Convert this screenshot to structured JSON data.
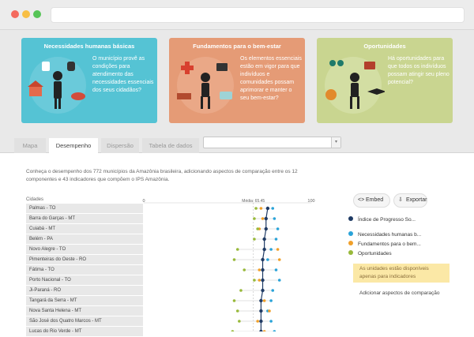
{
  "cards": [
    {
      "title": "Necessidades humanas básicas",
      "text": "O município provê as condições para atendimento das necessidades essenciais dos seus cidadãos?",
      "color": "#55c3d4"
    },
    {
      "title": "Fundamentos para o bem-estar",
      "text": "Os elementos essenciais estão em vigor para que indivíduos e comunidades possam aprimorar e manter o seu bem-estar?",
      "color": "#e59b76"
    },
    {
      "title": "Oportunidades",
      "text": "Há oportunidades para que todos os indivíduos possam atingir seu pleno potencial?",
      "color": "#c9d590"
    }
  ],
  "tabs": [
    {
      "label": "Mapa",
      "active": false
    },
    {
      "label": "Desempenho",
      "active": true
    },
    {
      "label": "Dispersão",
      "active": false
    },
    {
      "label": "Tabela de dados",
      "active": false
    }
  ],
  "intro": "Conheça o desempenho dos 772 municípios da Amazônia brasileira, adicionando aspectos de comparação entre os 12 componentes e 43 indicadores que compõem o IPS Amazônia.",
  "table": {
    "header": "Cidades",
    "rows": [
      "Palmas - TO",
      "Barra do Garças - MT",
      "Cuiabá - MT",
      "Belém - PA",
      "Novo Alegre - TO",
      "Pimenteiras do Oeste - RO",
      "Fátima - TO",
      "Porto Nacional - TO",
      "Ji-Paraná - RO",
      "Tangará da Serra - MT",
      "Nova Santa Helena - MT",
      "São José dos Quatro Marcos - MT",
      "Lucas do Rio Verde - MT"
    ]
  },
  "buttons": {
    "embed": "Embed",
    "export": "Exportar"
  },
  "legend": [
    {
      "label": "Índice de Progresso So...",
      "color": "#1f3a64"
    },
    {
      "label": "Necessidades humanas b...",
      "color": "#2aa3d8"
    },
    {
      "label": "Fundamentos para o bem...",
      "color": "#f0a02a"
    },
    {
      "label": "Oportunidades",
      "color": "#98b93a"
    }
  ],
  "notice": "As unidades estão disponíveis apenas para indicadores",
  "add_link": "Adicionar aspectos de comparação",
  "chart_data": {
    "type": "scatter",
    "axis_min": 0,
    "axis_max": 100,
    "axis_ticks": [
      "0",
      "100"
    ],
    "mean_label": "Média: 65.45",
    "mean_value": 65.45,
    "categories": [
      "Palmas - TO",
      "Barra do Garças - MT",
      "Cuiabá - MT",
      "Belém - PA",
      "Novo Alegre - TO",
      "Pimenteiras do Oeste - RO",
      "Fátima - TO",
      "Porto Nacional - TO",
      "Ji-Paraná - RO",
      "Tangará da Serra - MT",
      "Nova Santa Helena - MT",
      "São José dos Quatro Marcos - MT",
      "Lucas do Rio Verde - MT"
    ],
    "series": [
      {
        "name": "Índice de Progresso So...",
        "color": "#1f3a64",
        "values": [
          74,
          73,
          73,
          72,
          72,
          71,
          71,
          71,
          71,
          70,
          70,
          70,
          70
        ]
      },
      {
        "name": "Necessidades humanas b...",
        "color": "#2aa3d8",
        "values": [
          77,
          78,
          80,
          79,
          76,
          74,
          79,
          81,
          77,
          76,
          74,
          76,
          78
        ]
      },
      {
        "name": "Fundamentos para o bem...",
        "color": "#f0a02a",
        "values": [
          70,
          71,
          69,
          72,
          80,
          81,
          69,
          69,
          71,
          72,
          75,
          68,
          72
        ]
      },
      {
        "name": "Oportunidades",
        "color": "#98b93a",
        "values": [
          67,
          66,
          68,
          66,
          56,
          54,
          60,
          66,
          58,
          54,
          56,
          57,
          53
        ]
      }
    ]
  }
}
